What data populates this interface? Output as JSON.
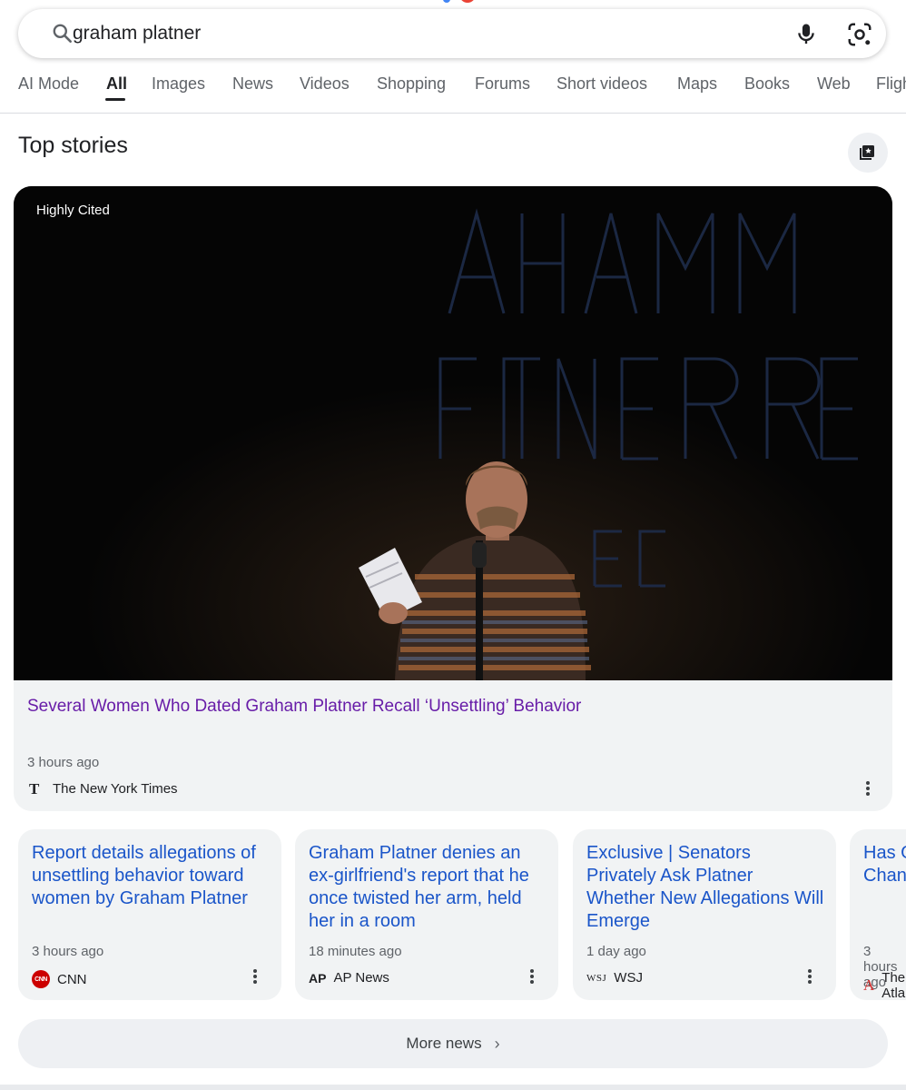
{
  "search": {
    "query": "graham platner",
    "search_icon": "search-icon",
    "mic_icon": "mic-icon",
    "lens_icon": "camera-lens-icon"
  },
  "tabs": [
    {
      "label": "AI Mode"
    },
    {
      "label": "All",
      "active": true
    },
    {
      "label": "Images"
    },
    {
      "label": "News"
    },
    {
      "label": "Videos"
    },
    {
      "label": "Shopping"
    },
    {
      "label": "Forums"
    },
    {
      "label": "Short videos"
    },
    {
      "label": "Maps"
    },
    {
      "label": "Books"
    },
    {
      "label": "Web"
    },
    {
      "label": "Flights"
    }
  ],
  "top_stories": {
    "title": "Top stories",
    "hero": {
      "badge": "Highly Cited",
      "headline": "Several Women Who Dated Graham Platner Recall ‘Unsettling’ Behavior",
      "time": "3 hours ago",
      "source": "The New York Times"
    },
    "cards": [
      {
        "headline": "Report details allegations of unsettling behavior toward women by Graham Platner",
        "time": "3 hours ago",
        "source": "CNN"
      },
      {
        "headline": "Graham Platner denies an ex-girlfriend's report that he once twisted her arm, held her in a room",
        "time": "18 minutes ago",
        "source": "AP News"
      },
      {
        "headline": "Exclusive | Senators Privately Ask Platner Whether New Allegations Will Emerge",
        "time": "1 day ago",
        "source": "WSJ"
      },
      {
        "headline": "Has Graham Platner Changed",
        "time": "3 hours ago",
        "source": "The Atlantic"
      }
    ],
    "more_label": "More news"
  },
  "colors": {
    "visited_link": "#681da8",
    "link": "#1a55c9",
    "card_bg": "#f1f3f4"
  }
}
